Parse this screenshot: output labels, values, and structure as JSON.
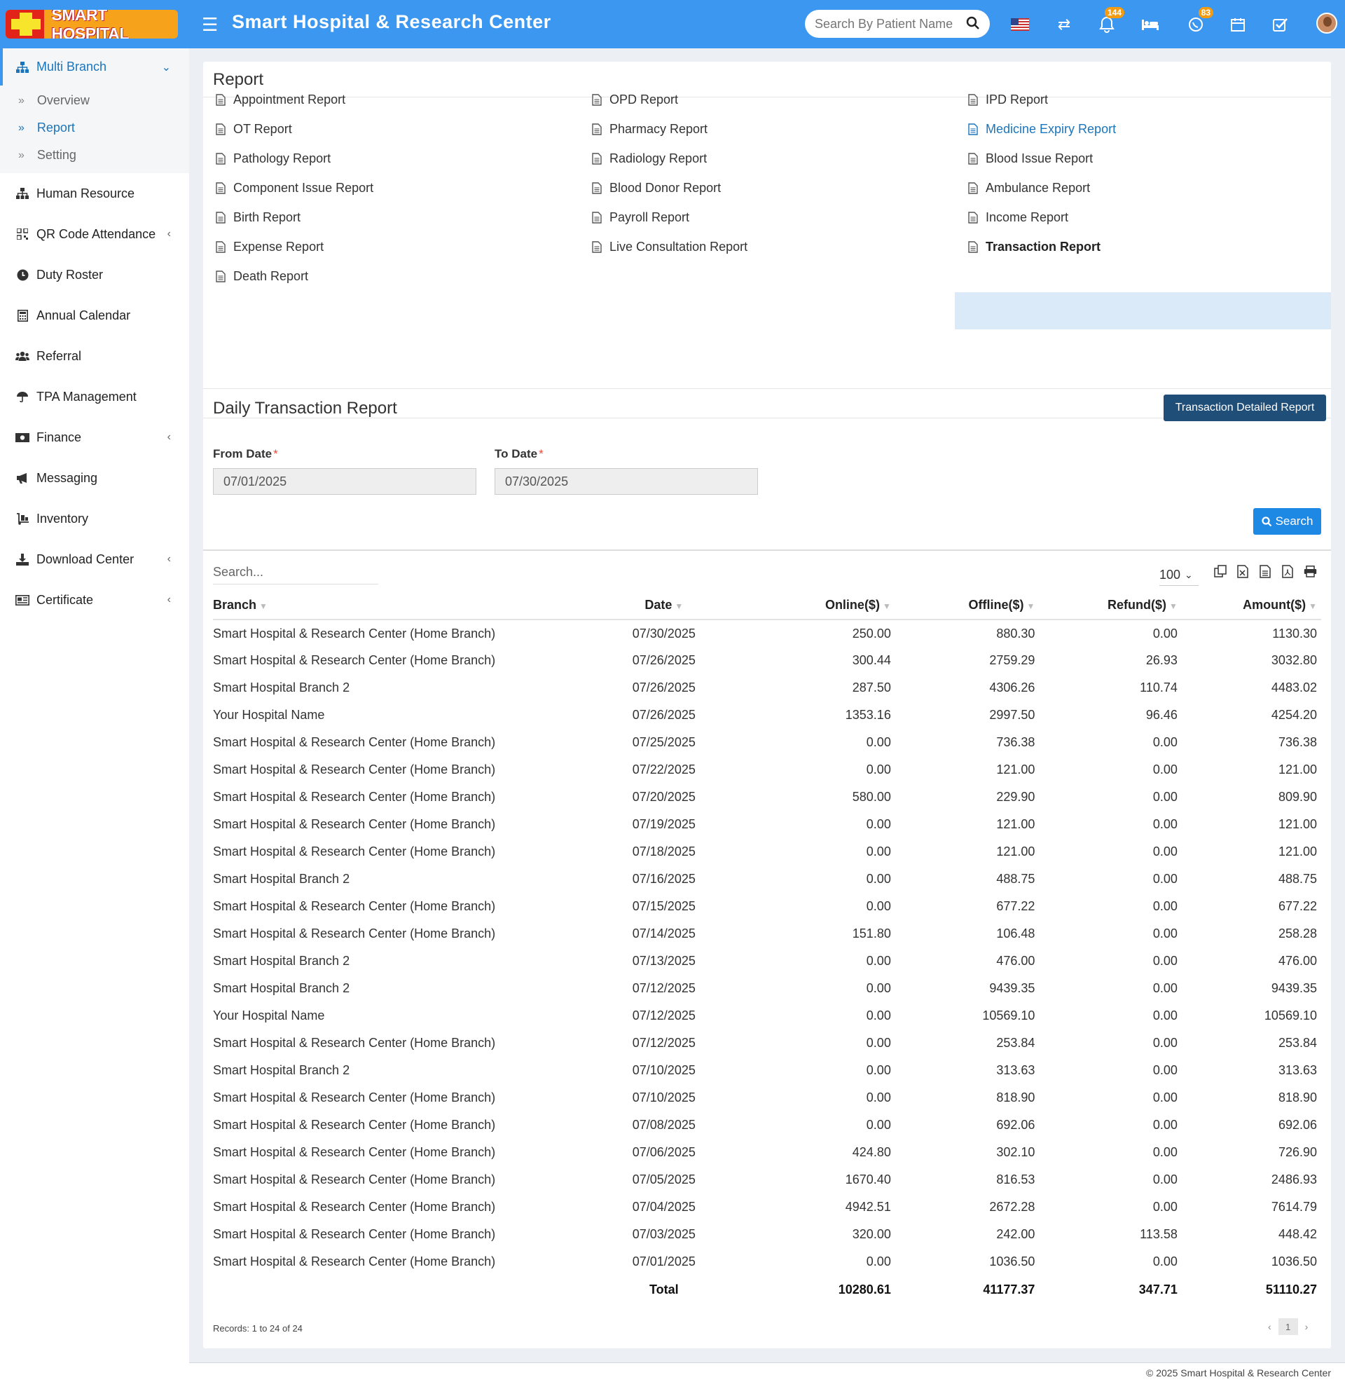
{
  "header": {
    "logo_text": "SMART HOSPITAL",
    "title": "Smart Hospital & Research Center",
    "search_placeholder": "Search By Patient Name",
    "notifications_badge": "144",
    "whatsapp_badge": "83"
  },
  "sidebar": {
    "active_group": "Multi Branch",
    "sub_items": [
      "Overview",
      "Report",
      "Setting"
    ],
    "items": [
      "Human Resource",
      "QR Code Attendance",
      "Duty Roster",
      "Annual Calendar",
      "Referral",
      "TPA Management",
      "Finance",
      "Messaging",
      "Inventory",
      "Download Center",
      "Certificate"
    ]
  },
  "report": {
    "title": "Report",
    "links": [
      [
        "Appointment Report",
        "OPD Report",
        "IPD Report"
      ],
      [
        "OT Report",
        "Pharmacy Report",
        "Medicine Expiry Report"
      ],
      [
        "Pathology Report",
        "Radiology Report",
        "Blood Issue Report"
      ],
      [
        "Component Issue Report",
        "Blood Donor Report",
        "Ambulance Report"
      ],
      [
        "Birth Report",
        "Payroll Report",
        "Income Report"
      ],
      [
        "Expense Report",
        "Live Consultation Report",
        "Transaction Report"
      ],
      [
        "Death Report"
      ]
    ]
  },
  "daily": {
    "title": "Daily Transaction Report",
    "detailed_button": "Transaction Detailed Report",
    "from_label": "From Date",
    "to_label": "To Date",
    "from_value": "07/01/2025",
    "to_value": "07/30/2025",
    "search_button": "Search",
    "table_search_placeholder": "Search...",
    "per_page": "100"
  },
  "table": {
    "headers": [
      "Branch",
      "Date",
      "Online($)",
      "Offline($)",
      "Refund($)",
      "Amount($)"
    ],
    "rows": [
      [
        "Smart Hospital & Research Center (Home Branch)",
        "07/30/2025",
        "250.00",
        "880.30",
        "0.00",
        "1130.30"
      ],
      [
        "Smart Hospital & Research Center (Home Branch)",
        "07/26/2025",
        "300.44",
        "2759.29",
        "26.93",
        "3032.80"
      ],
      [
        "Smart Hospital Branch 2",
        "07/26/2025",
        "287.50",
        "4306.26",
        "110.74",
        "4483.02"
      ],
      [
        "Your Hospital Name",
        "07/26/2025",
        "1353.16",
        "2997.50",
        "96.46",
        "4254.20"
      ],
      [
        "Smart Hospital & Research Center (Home Branch)",
        "07/25/2025",
        "0.00",
        "736.38",
        "0.00",
        "736.38"
      ],
      [
        "Smart Hospital & Research Center (Home Branch)",
        "07/22/2025",
        "0.00",
        "121.00",
        "0.00",
        "121.00"
      ],
      [
        "Smart Hospital & Research Center (Home Branch)",
        "07/20/2025",
        "580.00",
        "229.90",
        "0.00",
        "809.90"
      ],
      [
        "Smart Hospital & Research Center (Home Branch)",
        "07/19/2025",
        "0.00",
        "121.00",
        "0.00",
        "121.00"
      ],
      [
        "Smart Hospital & Research Center (Home Branch)",
        "07/18/2025",
        "0.00",
        "121.00",
        "0.00",
        "121.00"
      ],
      [
        "Smart Hospital Branch 2",
        "07/16/2025",
        "0.00",
        "488.75",
        "0.00",
        "488.75"
      ],
      [
        "Smart Hospital & Research Center (Home Branch)",
        "07/15/2025",
        "0.00",
        "677.22",
        "0.00",
        "677.22"
      ],
      [
        "Smart Hospital & Research Center (Home Branch)",
        "07/14/2025",
        "151.80",
        "106.48",
        "0.00",
        "258.28"
      ],
      [
        "Smart Hospital Branch 2",
        "07/13/2025",
        "0.00",
        "476.00",
        "0.00",
        "476.00"
      ],
      [
        "Smart Hospital Branch 2",
        "07/12/2025",
        "0.00",
        "9439.35",
        "0.00",
        "9439.35"
      ],
      [
        "Your Hospital Name",
        "07/12/2025",
        "0.00",
        "10569.10",
        "0.00",
        "10569.10"
      ],
      [
        "Smart Hospital & Research Center (Home Branch)",
        "07/12/2025",
        "0.00",
        "253.84",
        "0.00",
        "253.84"
      ],
      [
        "Smart Hospital Branch 2",
        "07/10/2025",
        "0.00",
        "313.63",
        "0.00",
        "313.63"
      ],
      [
        "Smart Hospital & Research Center (Home Branch)",
        "07/10/2025",
        "0.00",
        "818.90",
        "0.00",
        "818.90"
      ],
      [
        "Smart Hospital & Research Center (Home Branch)",
        "07/08/2025",
        "0.00",
        "692.06",
        "0.00",
        "692.06"
      ],
      [
        "Smart Hospital & Research Center (Home Branch)",
        "07/06/2025",
        "424.80",
        "302.10",
        "0.00",
        "726.90"
      ],
      [
        "Smart Hospital & Research Center (Home Branch)",
        "07/05/2025",
        "1670.40",
        "816.53",
        "0.00",
        "2486.93"
      ],
      [
        "Smart Hospital & Research Center (Home Branch)",
        "07/04/2025",
        "4942.51",
        "2672.28",
        "0.00",
        "7614.79"
      ],
      [
        "Smart Hospital & Research Center (Home Branch)",
        "07/03/2025",
        "320.00",
        "242.00",
        "113.58",
        "448.42"
      ],
      [
        "Smart Hospital & Research Center (Home Branch)",
        "07/01/2025",
        "0.00",
        "1036.50",
        "0.00",
        "1036.50"
      ]
    ],
    "total": [
      "Total",
      "10280.61",
      "41177.37",
      "347.71",
      "51110.27"
    ]
  },
  "records_text": "Records: 1 to 24 of 24",
  "page_number": "1",
  "footer": "© 2025 Smart Hospital & Research Center"
}
